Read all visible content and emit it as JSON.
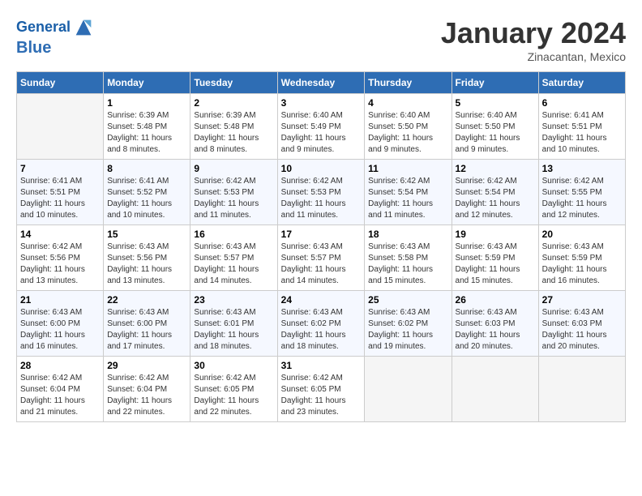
{
  "header": {
    "logo_line1": "General",
    "logo_line2": "Blue",
    "month_title": "January 2024",
    "location": "Zinacantan, Mexico"
  },
  "days_of_week": [
    "Sunday",
    "Monday",
    "Tuesday",
    "Wednesday",
    "Thursday",
    "Friday",
    "Saturday"
  ],
  "weeks": [
    [
      {
        "day": "",
        "info": ""
      },
      {
        "day": "1",
        "info": "Sunrise: 6:39 AM\nSunset: 5:48 PM\nDaylight: 11 hours\nand 8 minutes."
      },
      {
        "day": "2",
        "info": "Sunrise: 6:39 AM\nSunset: 5:48 PM\nDaylight: 11 hours\nand 8 minutes."
      },
      {
        "day": "3",
        "info": "Sunrise: 6:40 AM\nSunset: 5:49 PM\nDaylight: 11 hours\nand 9 minutes."
      },
      {
        "day": "4",
        "info": "Sunrise: 6:40 AM\nSunset: 5:50 PM\nDaylight: 11 hours\nand 9 minutes."
      },
      {
        "day": "5",
        "info": "Sunrise: 6:40 AM\nSunset: 5:50 PM\nDaylight: 11 hours\nand 9 minutes."
      },
      {
        "day": "6",
        "info": "Sunrise: 6:41 AM\nSunset: 5:51 PM\nDaylight: 11 hours\nand 10 minutes."
      }
    ],
    [
      {
        "day": "7",
        "info": "Sunrise: 6:41 AM\nSunset: 5:51 PM\nDaylight: 11 hours\nand 10 minutes."
      },
      {
        "day": "8",
        "info": "Sunrise: 6:41 AM\nSunset: 5:52 PM\nDaylight: 11 hours\nand 10 minutes."
      },
      {
        "day": "9",
        "info": "Sunrise: 6:42 AM\nSunset: 5:53 PM\nDaylight: 11 hours\nand 11 minutes."
      },
      {
        "day": "10",
        "info": "Sunrise: 6:42 AM\nSunset: 5:53 PM\nDaylight: 11 hours\nand 11 minutes."
      },
      {
        "day": "11",
        "info": "Sunrise: 6:42 AM\nSunset: 5:54 PM\nDaylight: 11 hours\nand 11 minutes."
      },
      {
        "day": "12",
        "info": "Sunrise: 6:42 AM\nSunset: 5:54 PM\nDaylight: 11 hours\nand 12 minutes."
      },
      {
        "day": "13",
        "info": "Sunrise: 6:42 AM\nSunset: 5:55 PM\nDaylight: 11 hours\nand 12 minutes."
      }
    ],
    [
      {
        "day": "14",
        "info": "Sunrise: 6:42 AM\nSunset: 5:56 PM\nDaylight: 11 hours\nand 13 minutes."
      },
      {
        "day": "15",
        "info": "Sunrise: 6:43 AM\nSunset: 5:56 PM\nDaylight: 11 hours\nand 13 minutes."
      },
      {
        "day": "16",
        "info": "Sunrise: 6:43 AM\nSunset: 5:57 PM\nDaylight: 11 hours\nand 14 minutes."
      },
      {
        "day": "17",
        "info": "Sunrise: 6:43 AM\nSunset: 5:57 PM\nDaylight: 11 hours\nand 14 minutes."
      },
      {
        "day": "18",
        "info": "Sunrise: 6:43 AM\nSunset: 5:58 PM\nDaylight: 11 hours\nand 15 minutes."
      },
      {
        "day": "19",
        "info": "Sunrise: 6:43 AM\nSunset: 5:59 PM\nDaylight: 11 hours\nand 15 minutes."
      },
      {
        "day": "20",
        "info": "Sunrise: 6:43 AM\nSunset: 5:59 PM\nDaylight: 11 hours\nand 16 minutes."
      }
    ],
    [
      {
        "day": "21",
        "info": "Sunrise: 6:43 AM\nSunset: 6:00 PM\nDaylight: 11 hours\nand 16 minutes."
      },
      {
        "day": "22",
        "info": "Sunrise: 6:43 AM\nSunset: 6:00 PM\nDaylight: 11 hours\nand 17 minutes."
      },
      {
        "day": "23",
        "info": "Sunrise: 6:43 AM\nSunset: 6:01 PM\nDaylight: 11 hours\nand 18 minutes."
      },
      {
        "day": "24",
        "info": "Sunrise: 6:43 AM\nSunset: 6:02 PM\nDaylight: 11 hours\nand 18 minutes."
      },
      {
        "day": "25",
        "info": "Sunrise: 6:43 AM\nSunset: 6:02 PM\nDaylight: 11 hours\nand 19 minutes."
      },
      {
        "day": "26",
        "info": "Sunrise: 6:43 AM\nSunset: 6:03 PM\nDaylight: 11 hours\nand 20 minutes."
      },
      {
        "day": "27",
        "info": "Sunrise: 6:43 AM\nSunset: 6:03 PM\nDaylight: 11 hours\nand 20 minutes."
      }
    ],
    [
      {
        "day": "28",
        "info": "Sunrise: 6:42 AM\nSunset: 6:04 PM\nDaylight: 11 hours\nand 21 minutes."
      },
      {
        "day": "29",
        "info": "Sunrise: 6:42 AM\nSunset: 6:04 PM\nDaylight: 11 hours\nand 22 minutes."
      },
      {
        "day": "30",
        "info": "Sunrise: 6:42 AM\nSunset: 6:05 PM\nDaylight: 11 hours\nand 22 minutes."
      },
      {
        "day": "31",
        "info": "Sunrise: 6:42 AM\nSunset: 6:05 PM\nDaylight: 11 hours\nand 23 minutes."
      },
      {
        "day": "",
        "info": ""
      },
      {
        "day": "",
        "info": ""
      },
      {
        "day": "",
        "info": ""
      }
    ]
  ]
}
